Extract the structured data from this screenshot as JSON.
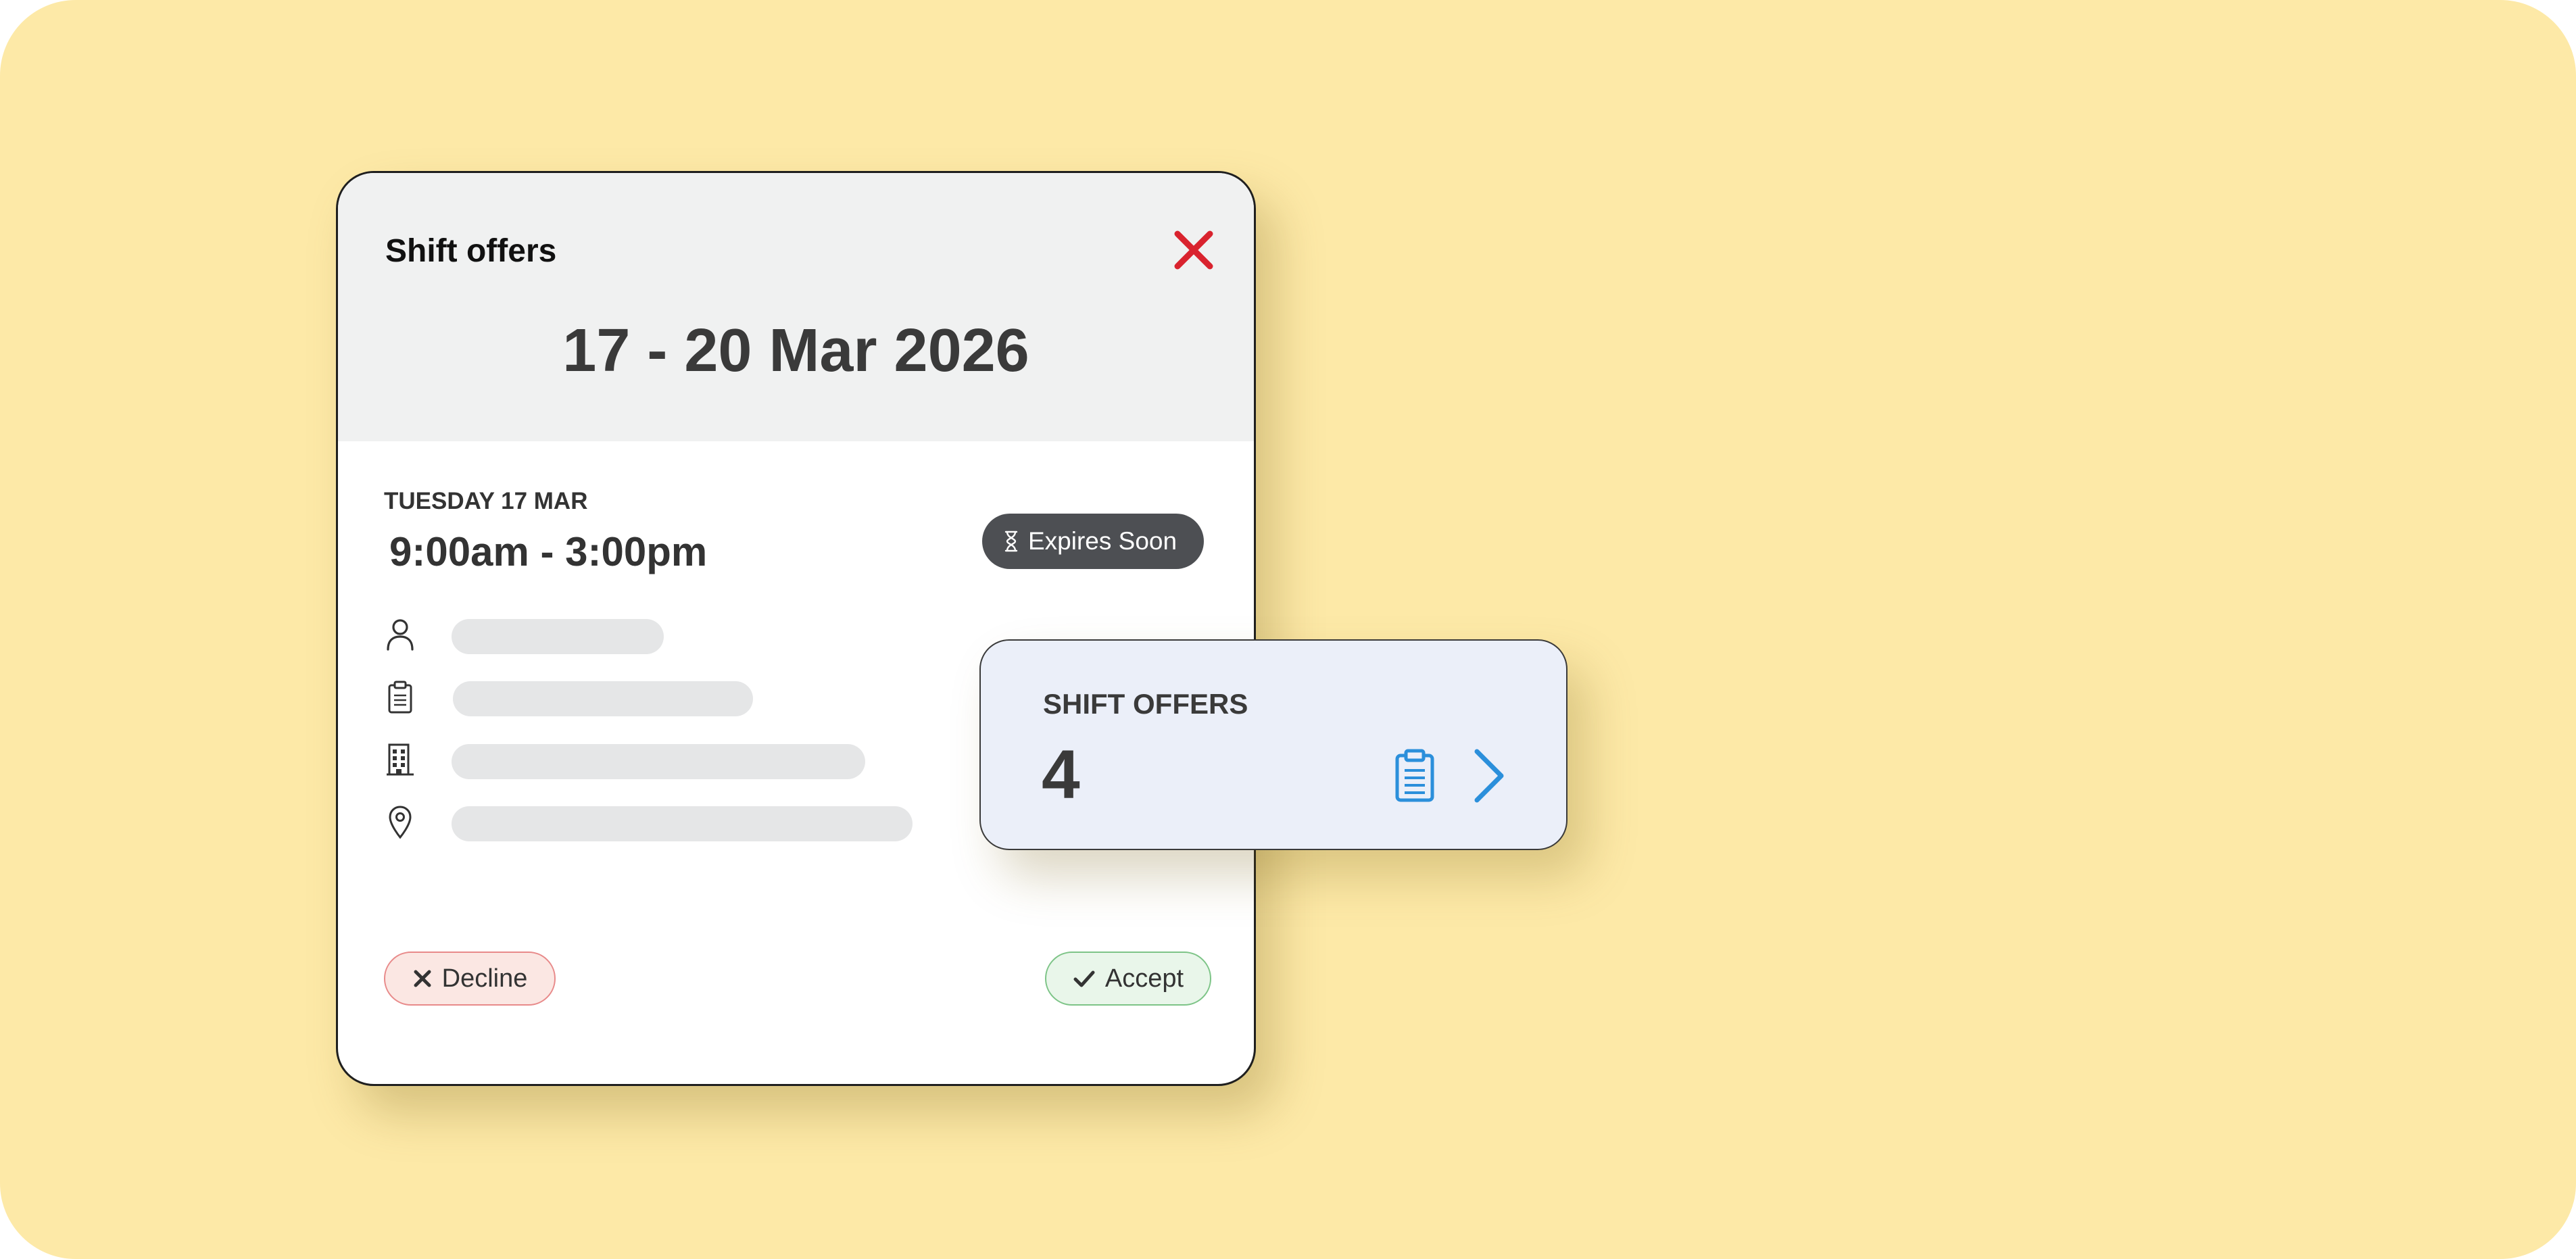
{
  "modal": {
    "title": "Shift offers",
    "date_range": "17 - 20 Mar 2026",
    "close_icon": "close-icon",
    "shift": {
      "day_label": "TUESDAY 17 MAR",
      "time_range": "9:00am - 3:00pm",
      "badge": {
        "label": "Expires Soon",
        "icon": "hourglass-icon"
      },
      "details": [
        {
          "icon": "person-icon"
        },
        {
          "icon": "clipboard-icon"
        },
        {
          "icon": "building-icon"
        },
        {
          "icon": "location-pin-icon"
        }
      ]
    },
    "actions": {
      "decline_label": "Decline",
      "accept_label": "Accept"
    }
  },
  "summary_card": {
    "title": "SHIFT OFFERS",
    "count": "4",
    "icon": "clipboard-icon",
    "chevron": "chevron-right-icon"
  },
  "colors": {
    "background": "#fde9a7",
    "close_red": "#d9232e",
    "accent_blue": "#2b8fdb",
    "badge_dark": "#4d4f53",
    "decline_bg": "#fbe7e3",
    "accept_bg": "#e9f6ea"
  }
}
